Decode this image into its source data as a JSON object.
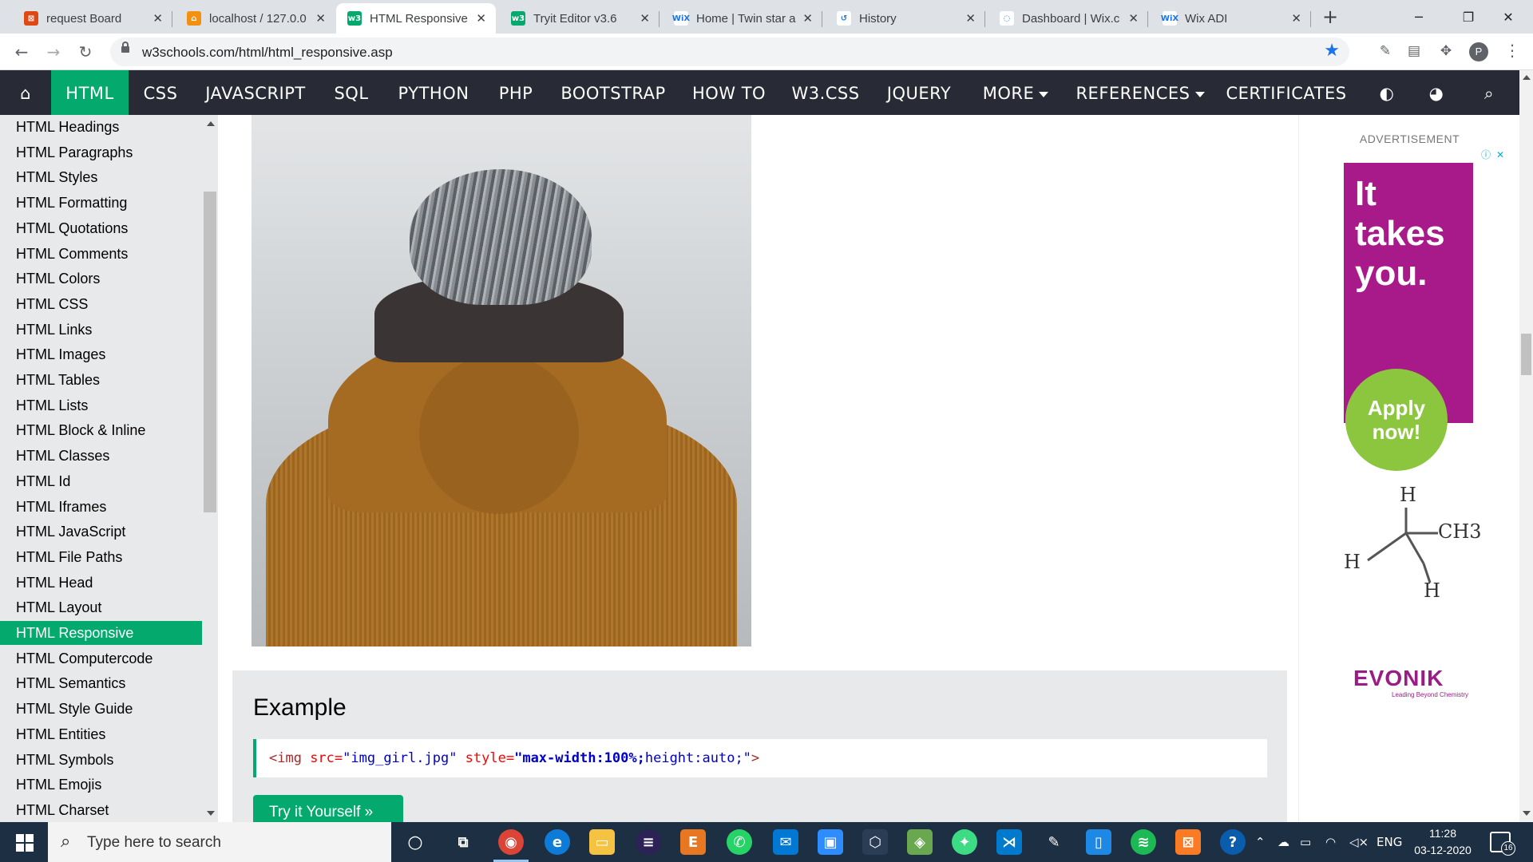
{
  "browser": {
    "tabs": [
      {
        "title": "request Board",
        "favicon": "codeigniter-icon",
        "favicon_color": "#dd4814",
        "favicon_glyph": "⊠"
      },
      {
        "title": "localhost / 127.0.0",
        "favicon": "phpmyadmin-icon",
        "favicon_color": "#f29111",
        "favicon_glyph": "⌂"
      },
      {
        "title": "HTML Responsive",
        "favicon": "w3schools-icon",
        "favicon_color": "#04aa6d",
        "favicon_glyph": "w3"
      },
      {
        "title": "Tryit Editor v3.6",
        "favicon": "w3schools-icon",
        "favicon_color": "#04aa6d",
        "favicon_glyph": "w3"
      },
      {
        "title": "Home | Twin star a",
        "favicon": "wix-icon",
        "favicon_color": "#ffffff",
        "favicon_glyph": "WiX"
      },
      {
        "title": "History",
        "favicon": "history-icon",
        "favicon_color": "#ffffff",
        "favicon_glyph": "↺"
      },
      {
        "title": "Dashboard | Wix.c",
        "favicon": "loading-icon",
        "favicon_color": "#ffffff",
        "favicon_glyph": "◌"
      },
      {
        "title": "Wix ADI",
        "favicon": "wix-icon",
        "favicon_color": "#ffffff",
        "favicon_glyph": "WiX"
      }
    ],
    "url": "w3schools.com/html/html_responsive.asp",
    "profile_initial": "P"
  },
  "topnav": {
    "items": [
      "HTML",
      "CSS",
      "JAVASCRIPT",
      "SQL",
      "PYTHON",
      "PHP",
      "BOOTSTRAP",
      "HOW TO",
      "W3.CSS",
      "JQUERY",
      "MORE",
      "REFERENCES",
      "CERTIFICATES"
    ],
    "active_item": "HTML",
    "accent_color": "#04aa6d"
  },
  "sidebar": {
    "items": [
      "HTML Headings",
      "HTML Paragraphs",
      "HTML Styles",
      "HTML Formatting",
      "HTML Quotations",
      "HTML Comments",
      "HTML Colors",
      "HTML CSS",
      "HTML Links",
      "HTML Images",
      "HTML Tables",
      "HTML Lists",
      "HTML Block & Inline",
      "HTML Classes",
      "HTML Id",
      "HTML Iframes",
      "HTML JavaScript",
      "HTML File Paths",
      "HTML Head",
      "HTML Layout",
      "HTML Responsive",
      "HTML Computercode",
      "HTML Semantics",
      "HTML Style Guide",
      "HTML Entities",
      "HTML Symbols",
      "HTML Emojis",
      "HTML Charset"
    ],
    "active_item": "HTML Responsive"
  },
  "main": {
    "example_title": "Example",
    "code": {
      "tag_open": "<img",
      "attr1": " src=",
      "val1": "\"img_girl.jpg\"",
      "attr2": " style=",
      "val2_bold": "\"max-width:100%;",
      "val2_rest": "height:auto;\"",
      "tag_close": ">"
    },
    "try_button": "Try it Yourself »"
  },
  "ad": {
    "label": "ADVERTISEMENT",
    "headline": "It takes you.",
    "cta": "Apply now!",
    "brand": "EVONIK",
    "brand_tagline": "Leading Beyond Chemistry",
    "molecule_labels": [
      "H",
      "CH3",
      "H",
      "H"
    ]
  },
  "taskbar": {
    "search_placeholder": "Type here to search",
    "language": "ENG",
    "time": "11:28",
    "date": "03-12-2020",
    "notification_count": "16"
  }
}
